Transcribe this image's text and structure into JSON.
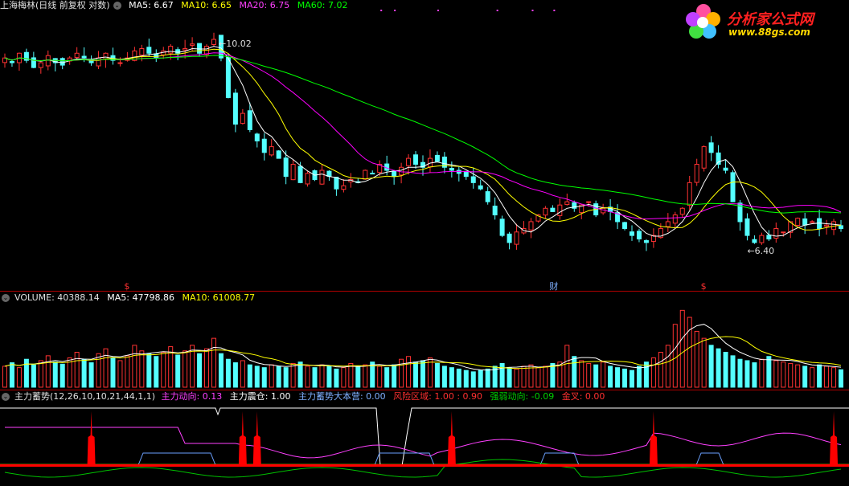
{
  "main_header": {
    "title": "上海梅林(日线 前复权 对数)",
    "ma5": "MA5: 6.67",
    "ma10": "MA10: 6.65",
    "ma20": "MA20: 6.75",
    "ma60": "MA60: 7.02"
  },
  "volume_header": {
    "title": "VOLUME: 40388.14",
    "ma5": "MA5: 47798.86",
    "ma10": "MA10: 61008.77"
  },
  "indicator_header": {
    "title": "主力蓄势(12,26,10,10,21,44,1,1)",
    "dir": "主力动向: 0.13",
    "shake": "主力震仓: 1.00",
    "camp": "主力蓄势大本营: 0.00",
    "risk": "风险区域: 1.00 : 0.90",
    "strength": "强弱动向: -0.09",
    "cross": "金叉: 0.00"
  },
  "annotations": {
    "high": "10.02",
    "low": "6.40",
    "marker_s": "$",
    "marker_cai": "财"
  },
  "logo": {
    "text": "分析家公式网",
    "url": "www.88gs.com"
  },
  "colors": {
    "up": "#ff3232",
    "down": "#54ffff",
    "ma5": "#ffffff",
    "ma10": "#ffff00",
    "ma20": "#ff00ff",
    "ma60": "#00ff00",
    "spike": "#ff0000",
    "camp_line": "#6aa0ff",
    "dir_line": "#ff40ff",
    "strength_line": "#00c000"
  },
  "chart_data": [
    {
      "type": "candlestick",
      "title": "上海梅林(日线 前复权 对数)",
      "log_scale": true,
      "y_range": [
        5.9,
        10.6
      ],
      "annotated_high": 10.02,
      "annotated_low": 6.4,
      "series": [
        {
          "name": "MA5",
          "value": 6.67
        },
        {
          "name": "MA10",
          "value": 6.65
        },
        {
          "name": "MA20",
          "value": 6.75
        },
        {
          "name": "MA60",
          "value": 7.02
        }
      ],
      "close_path": [
        9.6,
        9.5,
        9.7,
        9.55,
        9.4,
        9.5,
        9.65,
        9.5,
        9.45,
        9.6,
        9.7,
        9.6,
        9.5,
        9.6,
        9.7,
        9.55,
        9.5,
        9.6,
        9.75,
        9.8,
        9.7,
        9.6,
        9.75,
        9.85,
        9.7,
        9.8,
        9.9,
        9.7,
        9.85,
        10.0,
        9.6,
        8.8,
        8.3,
        8.5,
        8.2,
        8.0,
        7.8,
        7.9,
        7.7,
        7.4,
        7.6,
        7.3,
        7.45,
        7.35,
        7.5,
        7.4,
        7.2,
        7.25,
        7.35,
        7.3,
        7.5,
        7.45,
        7.6,
        7.5,
        7.4,
        7.55,
        7.7,
        7.6,
        7.55,
        7.7,
        7.65,
        7.55,
        7.5,
        7.45,
        7.4,
        7.3,
        7.2,
        7.0,
        6.8,
        6.5,
        6.4,
        6.55,
        6.6,
        6.7,
        6.8,
        6.9,
        6.85,
        6.95,
        7.0,
        6.9,
        6.95,
        7.0,
        6.8,
        6.9,
        6.85,
        6.7,
        6.6,
        6.5,
        6.45,
        6.4,
        6.5,
        6.6,
        6.7,
        6.8,
        6.9,
        7.3,
        7.6,
        7.9,
        7.8,
        7.6,
        7.5,
        7.0,
        6.7,
        6.5,
        6.4,
        6.5,
        6.45,
        6.6,
        6.55,
        6.7,
        6.75,
        6.65,
        6.7,
        6.6,
        6.65,
        6.7,
        6.6
      ]
    },
    {
      "type": "bar",
      "title": "VOLUME",
      "series": [
        {
          "name": "VOLUME",
          "value": 40388.14
        },
        {
          "name": "MA5",
          "value": 47798.86
        },
        {
          "name": "MA10",
          "value": 61008.77
        }
      ],
      "values": [
        30,
        35,
        28,
        40,
        32,
        38,
        45,
        36,
        33,
        42,
        50,
        40,
        35,
        48,
        55,
        42,
        38,
        45,
        60,
        52,
        48,
        44,
        50,
        58,
        46,
        52,
        60,
        48,
        55,
        70,
        48,
        40,
        35,
        38,
        32,
        30,
        28,
        32,
        30,
        28,
        34,
        36,
        30,
        28,
        32,
        30,
        26,
        28,
        34,
        30,
        32,
        36,
        30,
        28,
        32,
        40,
        44,
        36,
        38,
        42,
        34,
        30,
        28,
        26,
        24,
        22,
        24,
        26,
        30,
        34,
        28,
        26,
        30,
        32,
        28,
        30,
        34,
        36,
        60,
        44,
        38,
        34,
        32,
        36,
        30,
        28,
        26,
        24,
        30,
        36,
        42,
        50,
        60,
        90,
        110,
        100,
        80,
        70,
        60,
        55,
        50,
        45,
        40,
        38,
        35,
        40,
        44,
        38,
        36,
        34,
        32,
        30,
        28,
        32,
        30,
        28,
        25
      ]
    },
    {
      "type": "line",
      "title": "主力蓄势(12,26,10,10,21,44,1,1)",
      "series": [
        {
          "name": "主力动向",
          "value": 0.13
        },
        {
          "name": "主力震仓",
          "value": 1.0
        },
        {
          "name": "主力蓄势大本营",
          "value": 0.0
        },
        {
          "name": "风险区域",
          "value": 1.0
        },
        {
          "name": "强弱动向",
          "value": -0.09
        },
        {
          "name": "金叉",
          "value": 0.0
        }
      ],
      "spike_bars": [
        12,
        33,
        35,
        62,
        90,
        115
      ]
    }
  ]
}
